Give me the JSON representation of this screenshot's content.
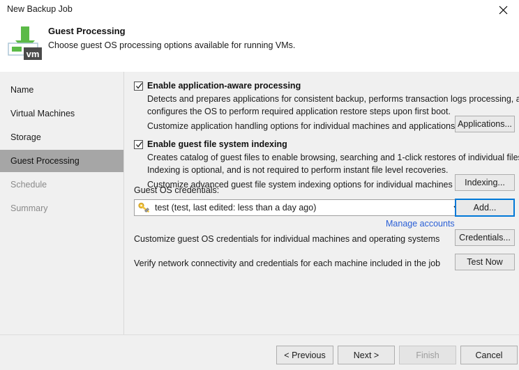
{
  "window": {
    "title": "New Backup Job",
    "close_icon": "close-icon"
  },
  "header": {
    "icon": "vm-guest-processing-icon",
    "title": "Guest Processing",
    "subtitle": "Choose guest OS processing options available for running VMs."
  },
  "sidebar": {
    "items": [
      {
        "label": "Name",
        "state": "normal"
      },
      {
        "label": "Virtual Machines",
        "state": "normal"
      },
      {
        "label": "Storage",
        "state": "normal"
      },
      {
        "label": "Guest Processing",
        "state": "selected"
      },
      {
        "label": "Schedule",
        "state": "disabled"
      },
      {
        "label": "Summary",
        "state": "disabled"
      }
    ]
  },
  "main": {
    "app_aware": {
      "checkbox_label": "Enable application-aware processing",
      "checked": true,
      "desc_line1": "Detects and prepares applications for consistent backup, performs transaction logs processing, and",
      "desc_line2": "configures the OS to perform required application restore steps upon first boot.",
      "customize_text": "Customize application handling options for individual machines and applications",
      "button_label": "Applications..."
    },
    "indexing": {
      "checkbox_label": "Enable guest file system indexing",
      "checked": true,
      "desc_line1": "Creates catalog of guest files to enable browsing, searching and 1-click restores of individual files.",
      "desc_line2": "Indexing is optional, and is not required to perform instant file level recoveries.",
      "customize_text": "Customize advanced guest file system indexing options for individual machines",
      "button_label": "Indexing..."
    },
    "credentials": {
      "label": "Guest OS credentials:",
      "selected_value": "test (test, last edited: less than a day ago)",
      "key_icon": "key-icon",
      "dropdown_icon": "chevron-down-icon",
      "add_button_label": "Add...",
      "manage_link_label": "Manage accounts",
      "customize_text": "Customize guest OS credentials for individual machines and operating systems",
      "credentials_button_label": "Credentials...",
      "verify_text": "Verify network connectivity and credentials for each machine included in the job",
      "test_button_label": "Test Now"
    }
  },
  "footer": {
    "previous_label": "< Previous",
    "next_label": "Next >",
    "finish_label": "Finish",
    "cancel_label": "Cancel",
    "finish_disabled": true
  },
  "colors": {
    "accent": "#0078d7",
    "link": "#2a5fd6",
    "selected_nav": "#a6a6a6",
    "panel": "#f0f0f0",
    "arrow_green": "#5bba47"
  }
}
